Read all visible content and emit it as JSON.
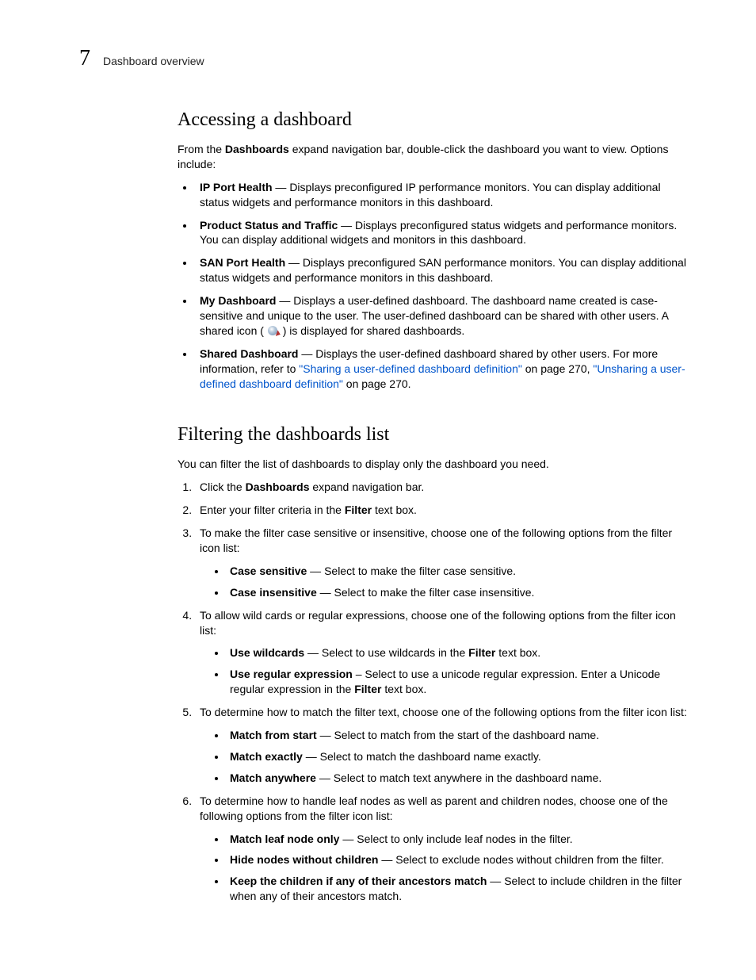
{
  "chapterNumber": "7",
  "breadcrumb": "Dashboard overview",
  "s1": {
    "heading": "Accessing a dashboard",
    "intro_pre": "From the ",
    "intro_bold": "Dashboards",
    "intro_post": " expand navigation bar, double-click the dashboard you want to view. Options include:",
    "items": [
      {
        "term": "IP Port Health",
        "desc": " — Displays preconfigured IP performance monitors. You can display additional status widgets and performance monitors in this dashboard."
      },
      {
        "term": "Product Status and Traffic",
        "desc": " — Displays preconfigured status widgets and performance monitors. You can display additional widgets and monitors in this dashboard."
      },
      {
        "term": "SAN Port Health",
        "desc": " — Displays preconfigured SAN performance monitors. You can display additional status widgets and performance monitors in this dashboard."
      }
    ],
    "myDash": {
      "term": "My Dashboard",
      "desc1": " — Displays a user-defined dashboard. The dashboard name created is case-sensitive and unique to the user. The user-defined dashboard can be shared with other users. A shared icon (",
      "desc2": ") is displayed for shared dashboards."
    },
    "shared": {
      "term": "Shared Dashboard",
      "desc1": " — Displays the user-defined dashboard shared by other users. For more information, refer to ",
      "link1": "\"Sharing a user-defined dashboard definition\"",
      "mid1": " on page 270, ",
      "link2": "\"Unsharing a user-defined dashboard definition\"",
      "mid2": " on page 270."
    }
  },
  "s2": {
    "heading": "Filtering the dashboards list",
    "intro": "You can filter the list of dashboards to display only the dashboard you need.",
    "step1_pre": "Click the ",
    "step1_bold": "Dashboards",
    "step1_post": " expand navigation bar.",
    "step2_pre": "Enter your filter criteria in the ",
    "step2_bold": "Filter",
    "step2_post": " text box.",
    "step3": "To make the filter case sensitive or insensitive, choose one of the following options from the filter icon list:",
    "step3_items": [
      {
        "term": "Case sensitive",
        "desc": " — Select to make the filter case sensitive."
      },
      {
        "term": "Case insensitive",
        "desc": " — Select to make the filter case insensitive."
      }
    ],
    "step4": "To allow wild cards or regular expressions, choose one of the following options from the filter icon list:",
    "step4_items": [
      {
        "term": "Use wildcards",
        "desc_pre": " — Select to use wildcards in the ",
        "desc_bold": "Filter",
        "desc_post": " text box."
      },
      {
        "term": "Use regular expression",
        "desc_pre": " – Select to use a unicode regular expression. Enter a Unicode regular expression in the ",
        "desc_bold": "Filter",
        "desc_post": " text box."
      }
    ],
    "step5": "To determine how to match the filter text, choose one of the following options from the filter icon list:",
    "step5_items": [
      {
        "term": "Match from start",
        "desc": " — Select to match from the start of the dashboard name."
      },
      {
        "term": "Match exactly",
        "desc": " — Select to match the dashboard name exactly."
      },
      {
        "term": "Match anywhere",
        "desc": " — Select to match text anywhere in the dashboard name."
      }
    ],
    "step6": "To determine how to handle leaf nodes as well as parent and children nodes, choose one of the following options from the filter icon list:",
    "step6_items": [
      {
        "term": "Match leaf node only",
        "desc": " — Select to only include leaf nodes in the filter."
      },
      {
        "term": "Hide nodes without children",
        "desc": " — Select to exclude nodes without children from the filter."
      },
      {
        "term": "Keep the children if any of their ancestors match",
        "desc": " — Select to include children in the filter when any of their ancestors match."
      }
    ]
  }
}
